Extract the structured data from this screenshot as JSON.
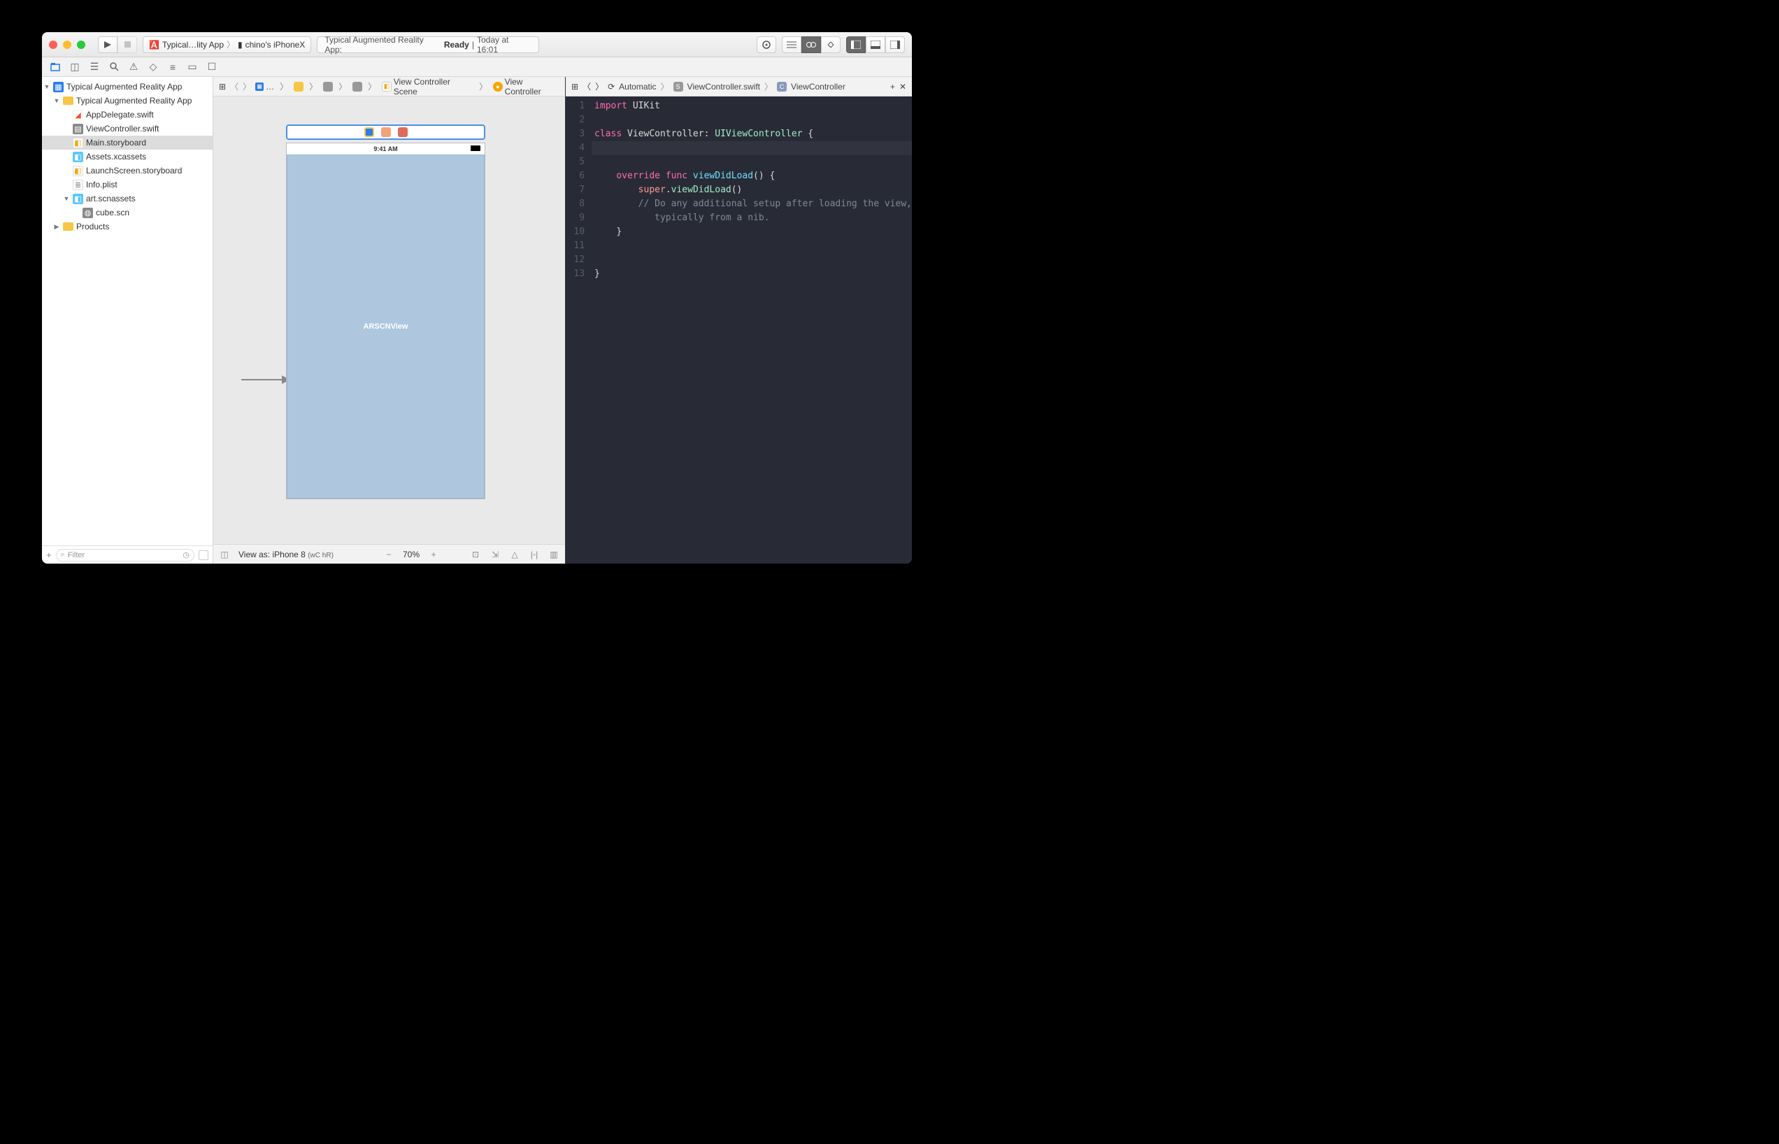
{
  "toolbar": {
    "scheme_target": "Typical…lity App",
    "scheme_device": "chino's iPhoneX",
    "activity_prefix": "Typical Augmented Reality App:",
    "activity_status": "Ready",
    "activity_sep": "|",
    "activity_time": "Today at 16:01"
  },
  "navigator": {
    "filter_placeholder": "Filter",
    "tree": {
      "root": "Typical Augmented Reality App",
      "group": "Typical Augmented Reality App",
      "items": [
        "AppDelegate.swift",
        "ViewController.swift",
        "Main.storyboard",
        "Assets.xcassets",
        "LaunchScreen.storyboard",
        "Info.plist"
      ],
      "art_group": "art.scnassets",
      "art_items": [
        "cube.scn"
      ],
      "products": "Products"
    }
  },
  "ib": {
    "crumbs": {
      "ellipsis": "…",
      "scene": "View Controller Scene",
      "vc": "View Controller"
    },
    "status_time": "9:41 AM",
    "ar_label": "ARSCNView",
    "footer": {
      "view_as_label": "View as:",
      "device": "iPhone 8",
      "size_prefix": "(",
      "size_w": "w",
      "size_c": "C",
      "size_h": " h",
      "size_r": "R",
      "size_suffix": ")",
      "zoom": "70%"
    }
  },
  "editor": {
    "jump": {
      "auto": "Automatic",
      "file": "ViewController.swift",
      "sym": "ViewController"
    },
    "code": {
      "l1_import": "import",
      "l1_uikit": " UIKit",
      "l3_class": "class",
      "l3_name": " ViewController: ",
      "l3_type": "UIViewController",
      "l3_brace": " {",
      "l5_override": "    override",
      "l5_func": " func",
      "l5_name": " viewDidLoad",
      "l5_paren": "() {",
      "l6_indent": "        ",
      "l6_super": "super",
      "l6_dot": ".",
      "l6_call": "viewDidLoad",
      "l6_paren": "()",
      "l7": "        // Do any additional setup after loading the view,\n           typically from a nib.",
      "l8": "    }",
      "l11": "}",
      "gutter": [
        "1",
        "2",
        "3",
        "4",
        "5",
        "6",
        "7",
        "8",
        "9",
        "10",
        "11",
        "12",
        "13"
      ]
    }
  }
}
